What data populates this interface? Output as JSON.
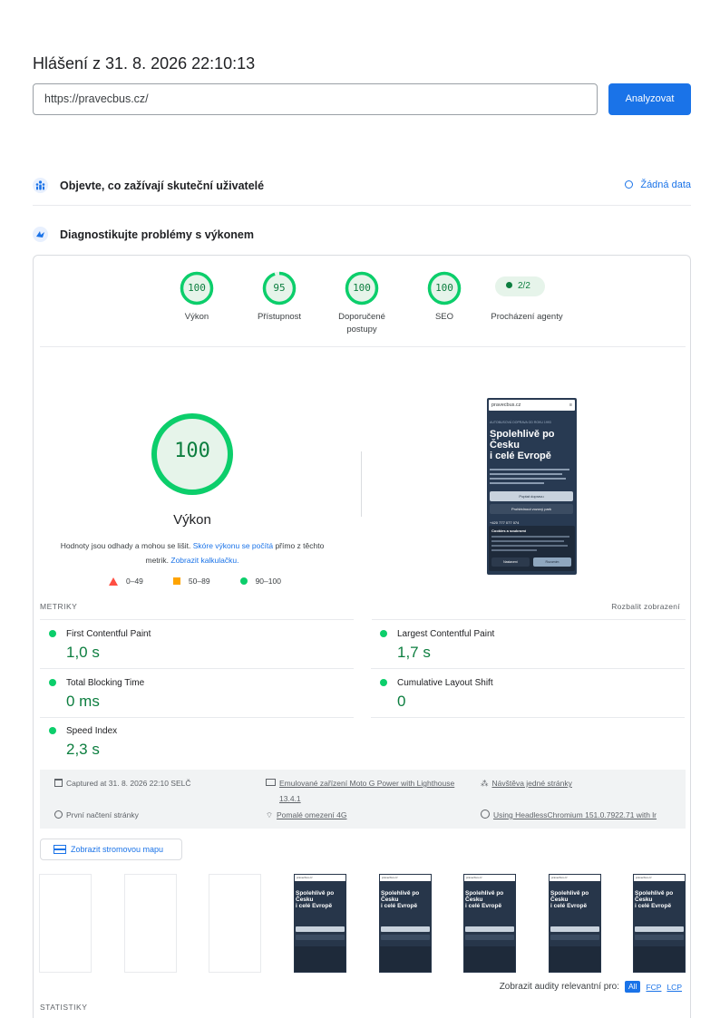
{
  "report": {
    "title": "Hlášení z 31. 8. 2026 22:10:13",
    "url_value": "https://pravecbus.cz/",
    "analyze_label": "Analyzovat"
  },
  "field_section": {
    "title": "Objevte, co zažívají skuteční uživatelé",
    "no_data_label": "Žádná data"
  },
  "diag_section": {
    "title": "Diagnostikujte problémy s výkonem"
  },
  "scores": [
    {
      "value": "100",
      "label": "Výkon",
      "fraction": 1.0
    },
    {
      "value": "95",
      "label": "Přístupnost",
      "fraction": 0.95
    },
    {
      "value": "100",
      "label": "Doporučené postupy",
      "fraction": 1.0
    },
    {
      "value": "100",
      "label": "SEO",
      "fraction": 1.0
    }
  ],
  "agents": {
    "pill": "2/2",
    "label": "Procházení agenty"
  },
  "performance": {
    "score": "100",
    "title": "Výkon",
    "desc_1": "Hodnoty jsou odhady a mohou se lišit.",
    "desc_link_1": "Skóre výkonu se počítá",
    "desc_2": "přímo z těchto metrik.",
    "desc_link_2": "Zobrazit kalkulačku.",
    "legend": [
      "0–49",
      "50–89",
      "90–100"
    ]
  },
  "preview": {
    "site": "pravecbus.cz",
    "tagline": "AUTOBUSOVÁ DOPRAVA OD ROKU 1993",
    "heading_1": "Spolehlivě po",
    "heading_2": "Česku",
    "heading_3": "i celé Evropě",
    "btn_1": "Poptat dopravu",
    "btn_2": "Prohlédnout vozový park",
    "phone": "+420 777 077 074",
    "cookie_title": "Cookies a soukromí",
    "cookie_btn_1": "Nastavení",
    "cookie_btn_2": "Rozumím"
  },
  "metrics": {
    "header": "METRIKY",
    "expand": "Rozbalit zobrazení",
    "items": [
      {
        "name": "First Contentful Paint",
        "value": "1,0 s"
      },
      {
        "name": "Largest Contentful Paint",
        "value": "1,7 s"
      },
      {
        "name": "Total Blocking Time",
        "value": "0 ms"
      },
      {
        "name": "Cumulative Layout Shift",
        "value": "0"
      },
      {
        "name": "Speed Index",
        "value": "2,3 s"
      }
    ]
  },
  "info": {
    "captured": "Captured at 31. 8. 2026 22:10 SELČ",
    "device_1": "Emulované zařízení Moto G Power with Lighthouse",
    "device_2": "13.4.1",
    "visit": "Návštěva jedné stránky",
    "first_load": "První načtení stránky",
    "throttle": "Pomalé omezení 4G",
    "browser": "Using HeadlessChromium 151.0.7922.71 with lr"
  },
  "tree_button": "Zobrazit stromovou mapu",
  "filter": {
    "label": "Zobrazit audity relevantní pro:",
    "all": "All",
    "fcp": "FCP",
    "lcp": "LCP"
  },
  "stats_header": "STATISTIKY",
  "colors": {
    "pass": "#0cce6b",
    "pass_text": "#0c7e3f",
    "average": "#ffa400",
    "fail": "#ff4e42",
    "accent": "#1a73e8"
  }
}
